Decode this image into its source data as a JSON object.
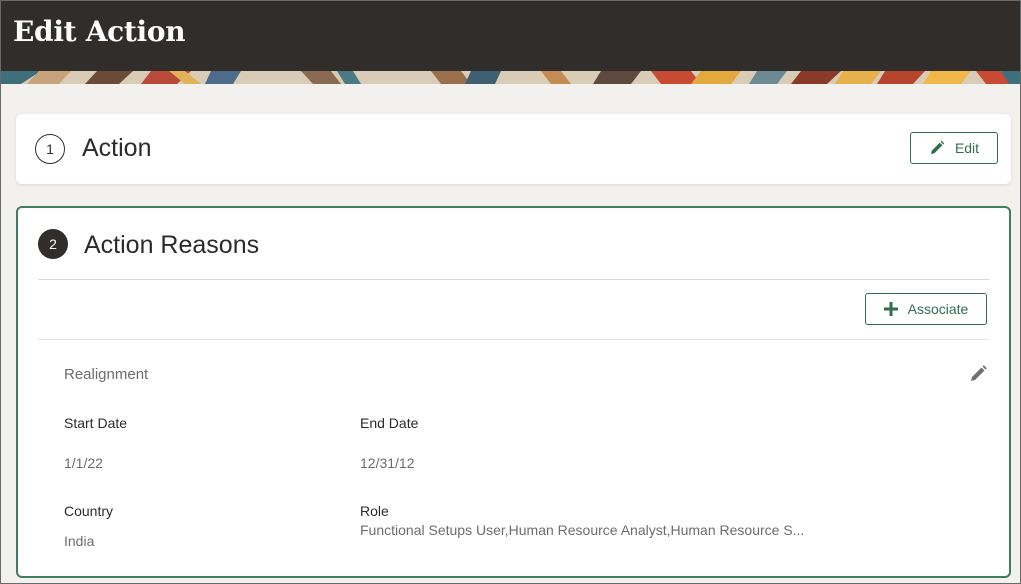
{
  "header": {
    "title": "Edit Action"
  },
  "sections": [
    {
      "number": "1",
      "title": "Action",
      "button_label": "Edit"
    },
    {
      "number": "2",
      "title": "Action Reasons",
      "button_label": "Associate"
    }
  ],
  "reason": {
    "name": "Realignment",
    "start_date_label": "Start Date",
    "start_date_value": "1/1/22",
    "end_date_label": "End Date",
    "end_date_value": "12/31/12",
    "country_label": "Country",
    "country_value": "India",
    "role_label": "Role",
    "role_value": "Functional Setups User,Human Resource Analyst,Human Resource S..."
  },
  "colors": {
    "header_bg": "#312d2a",
    "accent_green": "#2f6e4f",
    "card_border": "#3f7d5d"
  },
  "icons": {
    "edit_button_icon": "pencil-icon",
    "associate_button_icon": "plus-icon",
    "reason_edit_icon": "pencil-icon"
  }
}
